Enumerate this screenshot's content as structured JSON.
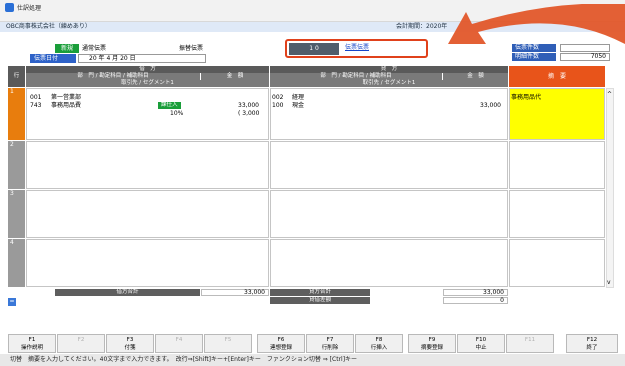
{
  "window": {
    "title": "仕訳処理"
  },
  "header": {
    "company": "OBC商事株式会社（練めあり）",
    "period": "会計期間：2020年",
    "slip_new": "新規",
    "slip_normal": "通常伝票",
    "slip_transfer": "振替伝票",
    "date_label": "伝票日付",
    "date_value": "20 年  4 月 20 日",
    "dark_field": "1  0",
    "link_text": "伝票伝票",
    "slip_count_label": "伝票件数",
    "detail_count_label": "明細件数",
    "detail_count_value": "7050"
  },
  "grid": {
    "row_header": "行",
    "debit_title": "借　方",
    "credit_title": "貸　方",
    "dept_acct_label": "部　門 / 勘定科目 / 補助科目",
    "amount_label": "金　額",
    "partner_label": "取引先 / セグメント1",
    "memo_header": "摘　要",
    "rows": [
      {
        "num": "1",
        "debit_dept_code": "001",
        "debit_dept": "第一営業部",
        "debit_acct_code": "743",
        "debit_acct": "事務用品費",
        "debit_tax": "課仕入",
        "debit_rate": "10%",
        "debit_amount": "33,000",
        "debit_tax_amount": "( 3,000",
        "credit_dept_code": "002",
        "credit_dept": "経理",
        "credit_acct_code": "100",
        "credit_acct": "現金",
        "credit_amount": "33,000",
        "memo": "事務用品代"
      },
      {
        "num": "2"
      },
      {
        "num": "3"
      },
      {
        "num": "4"
      }
    ]
  },
  "totals": {
    "debit_total_label": "借方合計",
    "debit_total": "33,000",
    "credit_total_label": "貸方合計",
    "credit_total": "33,000",
    "diff_label": "貸借差額",
    "diff_value": "0"
  },
  "fkeys": [
    {
      "key": "F1",
      "label": "操作説明",
      "enabled": true
    },
    {
      "key": "F2",
      "label": "",
      "enabled": false
    },
    {
      "key": "F3",
      "label": "付箋",
      "enabled": true
    },
    {
      "key": "F4",
      "label": "",
      "enabled": false
    },
    {
      "key": "F5",
      "label": "",
      "enabled": false
    },
    {
      "key": "F6",
      "label": "連想登録",
      "enabled": true
    },
    {
      "key": "F7",
      "label": "行削除",
      "enabled": true
    },
    {
      "key": "F8",
      "label": "行挿入",
      "enabled": true
    },
    {
      "key": "F9",
      "label": "摘要登録",
      "enabled": true
    },
    {
      "key": "F10",
      "label": "中止",
      "enabled": true
    },
    {
      "key": "F11",
      "label": "",
      "enabled": false
    },
    {
      "key": "F12",
      "label": "終了",
      "enabled": true
    }
  ],
  "status_bar": "切替　摘要を入力してください。40文字まで入力できます。　改行⇒[Shift]キー+[Enter]キー　ファンクション切替 ⇒ [Ctrl]キー",
  "colors": {
    "accent_orange": "#e0411b",
    "row_active": "#e87d0d",
    "memo_yellow": "#ffff00",
    "green_tag": "#1a9e3a"
  }
}
